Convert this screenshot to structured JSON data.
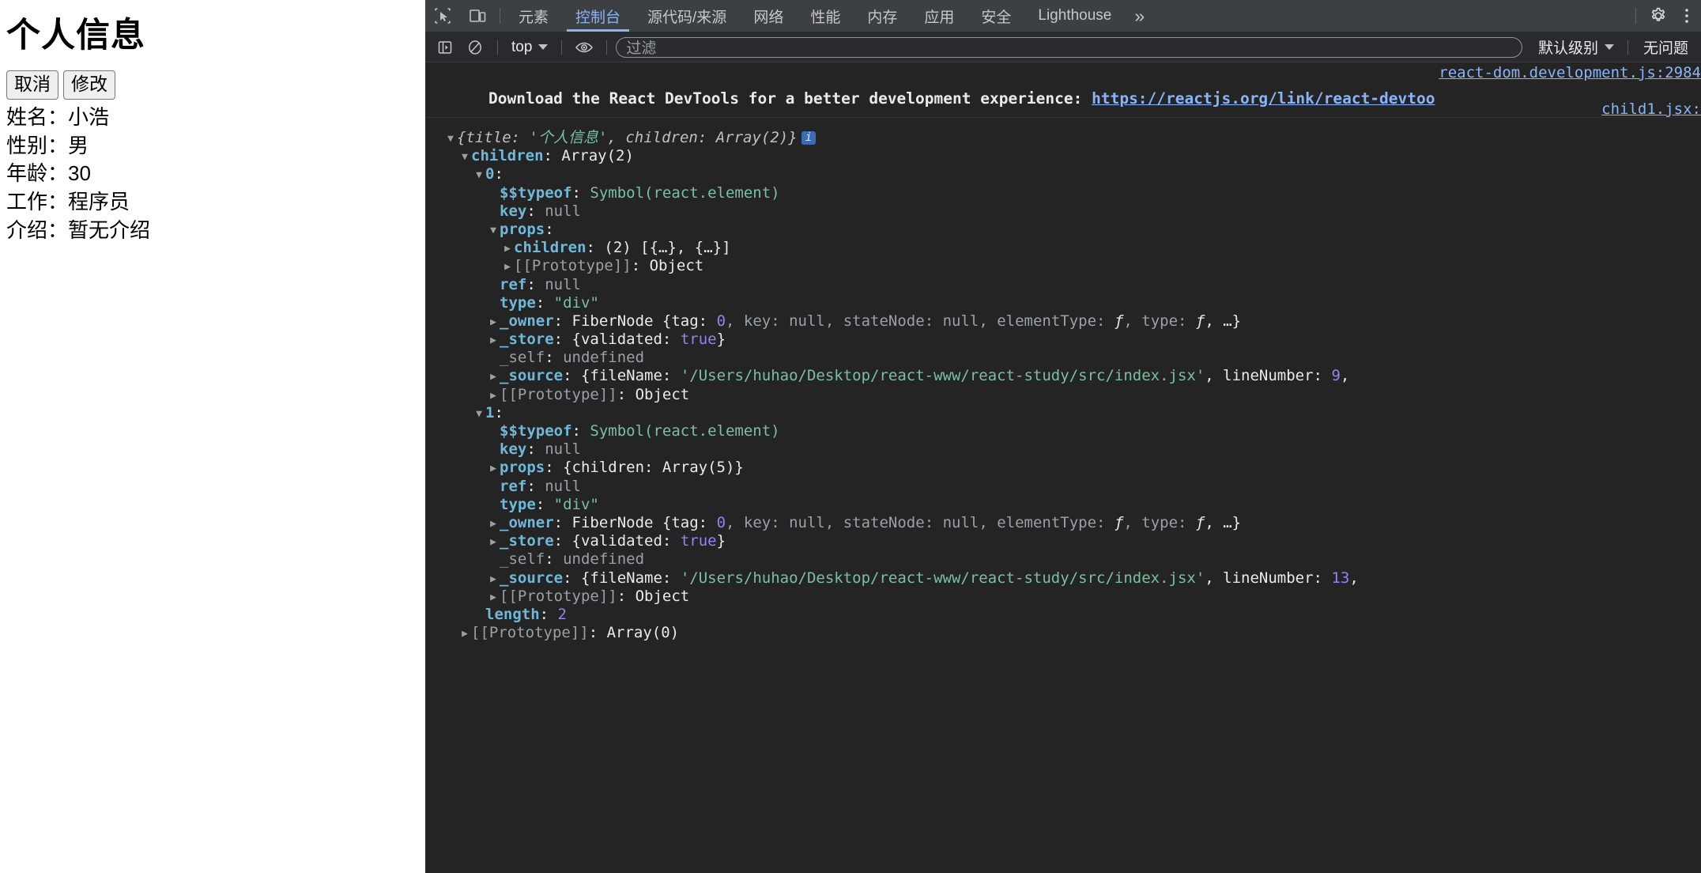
{
  "page": {
    "title": "个人信息",
    "buttons": [
      {
        "name": "cancel",
        "label": "取消"
      },
      {
        "name": "edit",
        "label": "修改"
      }
    ],
    "fields": [
      {
        "label": "姓名：",
        "value": "小浩"
      },
      {
        "label": "性别：",
        "value": "男"
      },
      {
        "label": "年龄：",
        "value": "30"
      },
      {
        "label": "工作：",
        "value": "程序员"
      },
      {
        "label": "介绍：",
        "value": "暂无介绍"
      }
    ]
  },
  "devtools": {
    "tabs": [
      {
        "label": "元素",
        "active": false
      },
      {
        "label": "控制台",
        "active": true
      },
      {
        "label": "源代码/来源",
        "active": false
      },
      {
        "label": "网络",
        "active": false
      },
      {
        "label": "性能",
        "active": false
      },
      {
        "label": "内存",
        "active": false
      },
      {
        "label": "应用",
        "active": false
      },
      {
        "label": "安全",
        "active": false
      },
      {
        "label": "Lighthouse",
        "active": false
      }
    ],
    "more_label": "»",
    "icons": {
      "inspect": "inspect-element-icon",
      "device": "device-toolbar-icon",
      "settings": "gear-icon",
      "menu": "kebab-menu-icon",
      "sidebar": "console-sidebar-icon",
      "clear": "clear-console-icon",
      "eye": "live-expression-icon"
    },
    "filterbar": {
      "context_label": "top",
      "filter_placeholder": "过滤",
      "filter_value": "",
      "level_label": "默认级别",
      "issues_label": "无问题"
    },
    "console": {
      "source_links": [
        "react-dom.development.js:2984",
        "child1.jsx:"
      ],
      "devtools_message": {
        "text": "Download the React DevTools for a better development experience: ",
        "link": "https://reactjs.org/link/react-devtoo"
      },
      "tree": [
        {
          "indent": 0,
          "tw": "down",
          "parts": [
            {
              "t": "{",
              "c": "italic-obj"
            },
            {
              "t": "title",
              "c": "italic-obj"
            },
            {
              "t": ": ",
              "c": "italic-obj"
            },
            {
              "t": "'个人信息'",
              "c": "v-str italic"
            },
            {
              "t": ", ",
              "c": "italic-obj"
            },
            {
              "t": "children",
              "c": "italic-obj"
            },
            {
              "t": ": ",
              "c": "italic-obj"
            },
            {
              "t": "Array(2)",
              "c": "italic-obj"
            },
            {
              "t": "}",
              "c": "italic-obj"
            },
            {
              "t": "i",
              "c": "info-badge"
            }
          ]
        },
        {
          "indent": 1,
          "tw": "down",
          "parts": [
            {
              "t": "children",
              "c": "k-prop"
            },
            {
              "t": ": ",
              "c": "k-plain"
            },
            {
              "t": "Array(2)",
              "c": "v-plain"
            }
          ]
        },
        {
          "indent": 2,
          "tw": "down",
          "parts": [
            {
              "t": "0",
              "c": "k-prop"
            },
            {
              "t": ":",
              "c": "k-plain"
            }
          ]
        },
        {
          "indent": 3,
          "tw": "none",
          "parts": [
            {
              "t": "$$typeof",
              "c": "k-prop"
            },
            {
              "t": ": ",
              "c": "k-plain"
            },
            {
              "t": "Symbol(react.element)",
              "c": "v-sym"
            }
          ]
        },
        {
          "indent": 3,
          "tw": "none",
          "parts": [
            {
              "t": "key",
              "c": "k-prop"
            },
            {
              "t": ": ",
              "c": "k-plain"
            },
            {
              "t": "null",
              "c": "v-null"
            }
          ]
        },
        {
          "indent": 3,
          "tw": "down",
          "parts": [
            {
              "t": "props",
              "c": "k-prop"
            },
            {
              "t": ":",
              "c": "k-plain"
            }
          ]
        },
        {
          "indent": 4,
          "tw": "right",
          "parts": [
            {
              "t": "children",
              "c": "k-prop"
            },
            {
              "t": ": ",
              "c": "k-plain"
            },
            {
              "t": "(2) [{…}, {…}]",
              "c": "v-plain"
            }
          ]
        },
        {
          "indent": 4,
          "tw": "right",
          "parts": [
            {
              "t": "[[Prototype]]",
              "c": "k-gray"
            },
            {
              "t": ": ",
              "c": "k-plain"
            },
            {
              "t": "Object",
              "c": "v-plain"
            }
          ]
        },
        {
          "indent": 3,
          "tw": "none",
          "parts": [
            {
              "t": "ref",
              "c": "k-prop"
            },
            {
              "t": ": ",
              "c": "k-plain"
            },
            {
              "t": "null",
              "c": "v-null"
            }
          ]
        },
        {
          "indent": 3,
          "tw": "none",
          "parts": [
            {
              "t": "type",
              "c": "k-prop"
            },
            {
              "t": ": ",
              "c": "k-plain"
            },
            {
              "t": "\"div\"",
              "c": "v-str"
            }
          ]
        },
        {
          "indent": 3,
          "tw": "right",
          "parts": [
            {
              "t": "_owner",
              "c": "k-prop"
            },
            {
              "t": ": ",
              "c": "k-plain"
            },
            {
              "t": "FiberNode {tag: ",
              "c": "v-plain"
            },
            {
              "t": "0",
              "c": "v-num"
            },
            {
              "t": ", key: ",
              "c": "v-null"
            },
            {
              "t": "null",
              "c": "v-null"
            },
            {
              "t": ", stateNode: ",
              "c": "v-null"
            },
            {
              "t": "null",
              "c": "v-null"
            },
            {
              "t": ", elementType: ",
              "c": "v-null"
            },
            {
              "t": "ƒ",
              "c": "fn-ital"
            },
            {
              "t": ", type: ",
              "c": "v-null"
            },
            {
              "t": "ƒ",
              "c": "fn-ital"
            },
            {
              "t": ", …}",
              "c": "v-plain"
            }
          ]
        },
        {
          "indent": 3,
          "tw": "right",
          "parts": [
            {
              "t": "_store",
              "c": "k-prop"
            },
            {
              "t": ": ",
              "c": "k-plain"
            },
            {
              "t": "{validated: ",
              "c": "v-plain"
            },
            {
              "t": "true",
              "c": "v-kw"
            },
            {
              "t": "}",
              "c": "v-plain"
            }
          ]
        },
        {
          "indent": 3,
          "tw": "none",
          "parts": [
            {
              "t": "_self",
              "c": "k-gray"
            },
            {
              "t": ": ",
              "c": "k-plain"
            },
            {
              "t": "undefined",
              "c": "v-null"
            }
          ]
        },
        {
          "indent": 3,
          "tw": "right",
          "parts": [
            {
              "t": "_source",
              "c": "k-prop"
            },
            {
              "t": ": ",
              "c": "k-plain"
            },
            {
              "t": "{fileName: ",
              "c": "v-plain"
            },
            {
              "t": "'/Users/huhao/Desktop/react-www/react-study/src/index.jsx'",
              "c": "v-str"
            },
            {
              "t": ", lineNumber: ",
              "c": "v-plain"
            },
            {
              "t": "9",
              "c": "v-num"
            },
            {
              "t": ",",
              "c": "v-plain"
            }
          ]
        },
        {
          "indent": 3,
          "tw": "right",
          "parts": [
            {
              "t": "[[Prototype]]",
              "c": "k-gray"
            },
            {
              "t": ": ",
              "c": "k-plain"
            },
            {
              "t": "Object",
              "c": "v-plain"
            }
          ]
        },
        {
          "indent": 2,
          "tw": "down",
          "parts": [
            {
              "t": "1",
              "c": "k-prop"
            },
            {
              "t": ":",
              "c": "k-plain"
            }
          ]
        },
        {
          "indent": 3,
          "tw": "none",
          "parts": [
            {
              "t": "$$typeof",
              "c": "k-prop"
            },
            {
              "t": ": ",
              "c": "k-plain"
            },
            {
              "t": "Symbol(react.element)",
              "c": "v-sym"
            }
          ]
        },
        {
          "indent": 3,
          "tw": "none",
          "parts": [
            {
              "t": "key",
              "c": "k-prop"
            },
            {
              "t": ": ",
              "c": "k-plain"
            },
            {
              "t": "null",
              "c": "v-null"
            }
          ]
        },
        {
          "indent": 3,
          "tw": "right",
          "parts": [
            {
              "t": "props",
              "c": "k-prop"
            },
            {
              "t": ": ",
              "c": "k-plain"
            },
            {
              "t": "{children: Array(5)}",
              "c": "v-plain"
            }
          ]
        },
        {
          "indent": 3,
          "tw": "none",
          "parts": [
            {
              "t": "ref",
              "c": "k-prop"
            },
            {
              "t": ": ",
              "c": "k-plain"
            },
            {
              "t": "null",
              "c": "v-null"
            }
          ]
        },
        {
          "indent": 3,
          "tw": "none",
          "parts": [
            {
              "t": "type",
              "c": "k-prop"
            },
            {
              "t": ": ",
              "c": "k-plain"
            },
            {
              "t": "\"div\"",
              "c": "v-str"
            }
          ]
        },
        {
          "indent": 3,
          "tw": "right",
          "parts": [
            {
              "t": "_owner",
              "c": "k-prop"
            },
            {
              "t": ": ",
              "c": "k-plain"
            },
            {
              "t": "FiberNode {tag: ",
              "c": "v-plain"
            },
            {
              "t": "0",
              "c": "v-num"
            },
            {
              "t": ", key: ",
              "c": "v-null"
            },
            {
              "t": "null",
              "c": "v-null"
            },
            {
              "t": ", stateNode: ",
              "c": "v-null"
            },
            {
              "t": "null",
              "c": "v-null"
            },
            {
              "t": ", elementType: ",
              "c": "v-null"
            },
            {
              "t": "ƒ",
              "c": "fn-ital"
            },
            {
              "t": ", type: ",
              "c": "v-null"
            },
            {
              "t": "ƒ",
              "c": "fn-ital"
            },
            {
              "t": ", …}",
              "c": "v-plain"
            }
          ]
        },
        {
          "indent": 3,
          "tw": "right",
          "parts": [
            {
              "t": "_store",
              "c": "k-prop"
            },
            {
              "t": ": ",
              "c": "k-plain"
            },
            {
              "t": "{validated: ",
              "c": "v-plain"
            },
            {
              "t": "true",
              "c": "v-kw"
            },
            {
              "t": "}",
              "c": "v-plain"
            }
          ]
        },
        {
          "indent": 3,
          "tw": "none",
          "parts": [
            {
              "t": "_self",
              "c": "k-gray"
            },
            {
              "t": ": ",
              "c": "k-plain"
            },
            {
              "t": "undefined",
              "c": "v-null"
            }
          ]
        },
        {
          "indent": 3,
          "tw": "right",
          "parts": [
            {
              "t": "_source",
              "c": "k-prop"
            },
            {
              "t": ": ",
              "c": "k-plain"
            },
            {
              "t": "{fileName: ",
              "c": "v-plain"
            },
            {
              "t": "'/Users/huhao/Desktop/react-www/react-study/src/index.jsx'",
              "c": "v-str"
            },
            {
              "t": ", lineNumber: ",
              "c": "v-plain"
            },
            {
              "t": "13",
              "c": "v-num"
            },
            {
              "t": ",",
              "c": "v-plain"
            }
          ]
        },
        {
          "indent": 3,
          "tw": "right",
          "parts": [
            {
              "t": "[[Prototype]]",
              "c": "k-gray"
            },
            {
              "t": ": ",
              "c": "k-plain"
            },
            {
              "t": "Object",
              "c": "v-plain"
            }
          ]
        },
        {
          "indent": 2,
          "tw": "none",
          "parts": [
            {
              "t": "length",
              "c": "k-prop"
            },
            {
              "t": ": ",
              "c": "k-plain"
            },
            {
              "t": "2",
              "c": "v-num"
            }
          ]
        },
        {
          "indent": 1,
          "tw": "right",
          "parts": [
            {
              "t": "[[Prototype]]",
              "c": "k-gray"
            },
            {
              "t": ": ",
              "c": "k-plain"
            },
            {
              "t": "Array(0)",
              "c": "v-plain"
            }
          ]
        }
      ]
    }
  }
}
